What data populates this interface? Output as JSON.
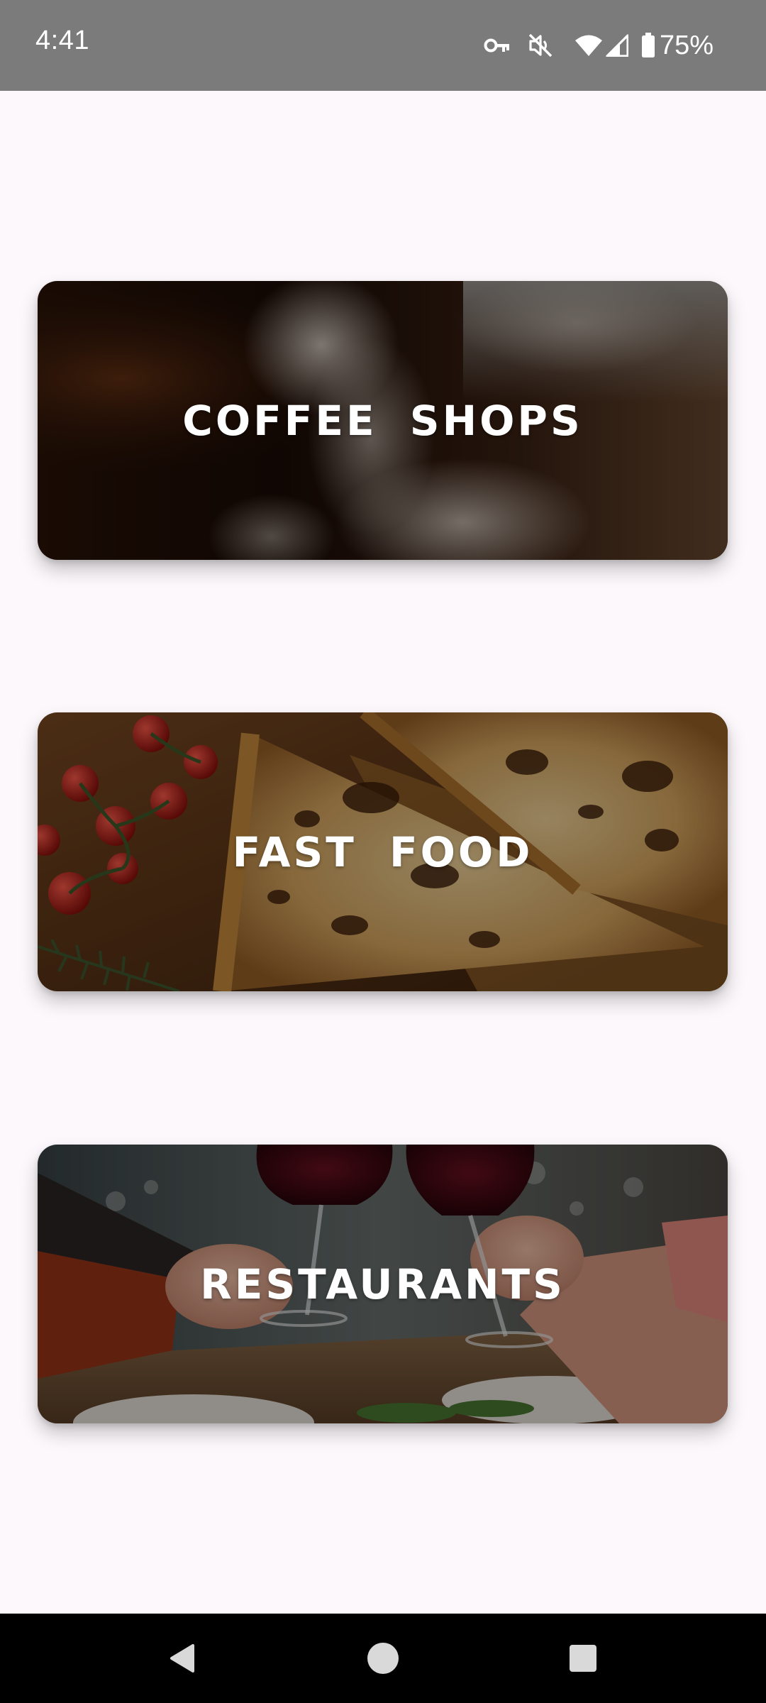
{
  "status_bar": {
    "time": "4:41",
    "battery_percent": "75%",
    "icons": [
      "vpn-key-icon",
      "vibrate-off-icon",
      "wifi-icon",
      "cell-signal-icon",
      "battery-icon"
    ]
  },
  "categories": [
    {
      "label": "COFFEE SHOPS",
      "image": "coffee-steam-photo"
    },
    {
      "label": "FAST FOOD",
      "image": "pizza-tomatoes-photo"
    },
    {
      "label": "RESTAURANTS",
      "image": "wine-toast-photo"
    }
  ],
  "nav_bar": {
    "buttons": [
      "back-icon",
      "home-icon",
      "recents-icon"
    ]
  },
  "colors": {
    "status_bar": "#7b7b7b",
    "background": "#fcf8fc",
    "nav_bar": "#000000",
    "card_text": "#ffffff"
  }
}
